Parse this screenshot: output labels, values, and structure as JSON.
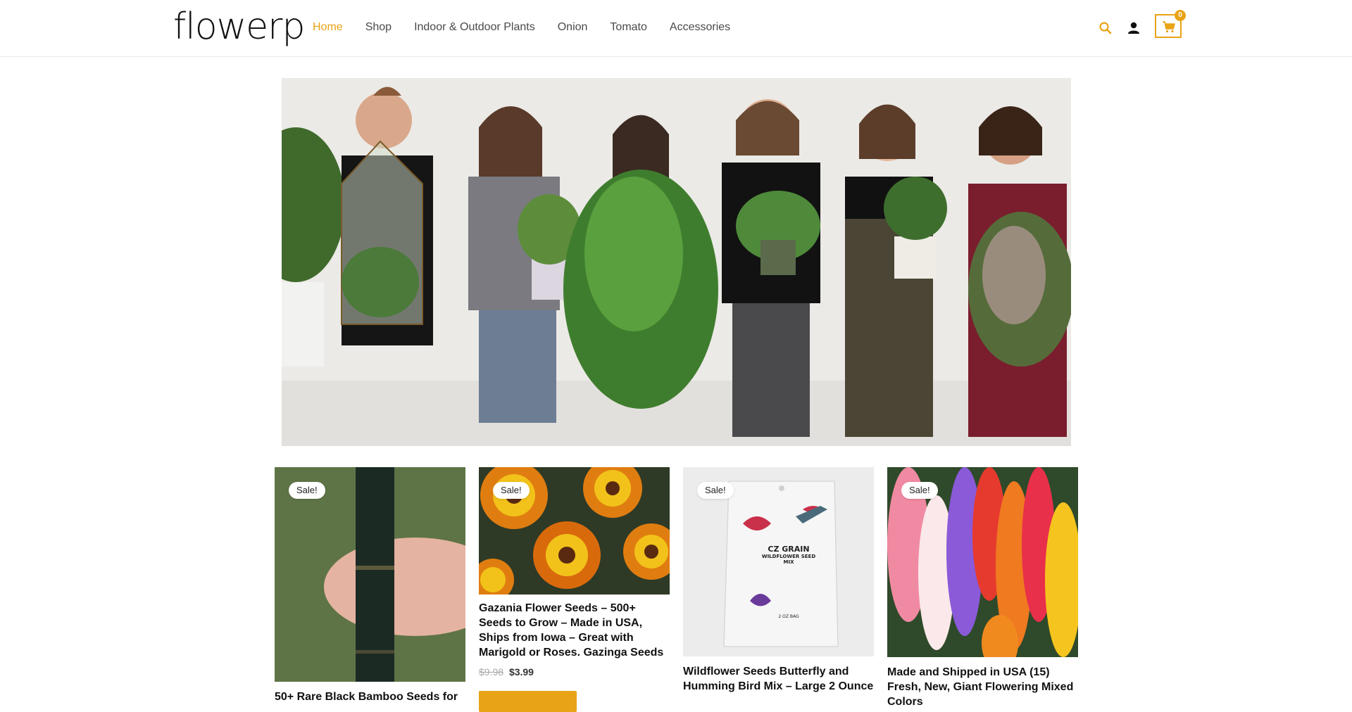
{
  "brand": {
    "logo_text": "flowerp"
  },
  "nav": {
    "items": [
      {
        "label": "Home",
        "active": true
      },
      {
        "label": "Shop",
        "active": false
      },
      {
        "label": "Indoor & Outdoor Plants",
        "active": false
      },
      {
        "label": "Onion",
        "active": false
      },
      {
        "label": "Tomato",
        "active": false
      },
      {
        "label": "Accessories",
        "active": false
      }
    ]
  },
  "header_icons": {
    "search": "search-icon",
    "account": "user-icon",
    "cart": "cart-icon",
    "cart_count": "0"
  },
  "colors": {
    "accent": "#e8a316",
    "text": "#4a4a4a",
    "border": "#e9e9e9"
  },
  "hero": {
    "image": "group-of-people-holding-potted-plants"
  },
  "products": [
    {
      "badge": "Sale!",
      "title": "50+ Rare Black Bamboo Seeds for",
      "image": "black-bamboo-stalk"
    },
    {
      "badge": "Sale!",
      "title": "Gazania Flower Seeds – 500+ Seeds to Grow – Made in USA, Ships from Iowa – Great with Marigold or Roses. Gazinga Seeds",
      "price_old": "$9.98",
      "price_new": "$3.99",
      "image": "gazania-flowers"
    },
    {
      "badge": "Sale!",
      "title": "Wildflower Seeds Butterfly and Humming Bird Mix – Large 2 Ounce",
      "image": "wildflower-seed-bag",
      "packet_brand": "CZ GRAIN",
      "packet_line1": "WILDFLOWER SEED",
      "packet_line2": "MIX",
      "packet_size": "2 OZ BAG"
    },
    {
      "badge": "Sale!",
      "title": "Made and Shipped in USA (15) Fresh, New, Giant Flowering Mixed Colors",
      "image": "gladiolus-mixed-colors"
    }
  ]
}
